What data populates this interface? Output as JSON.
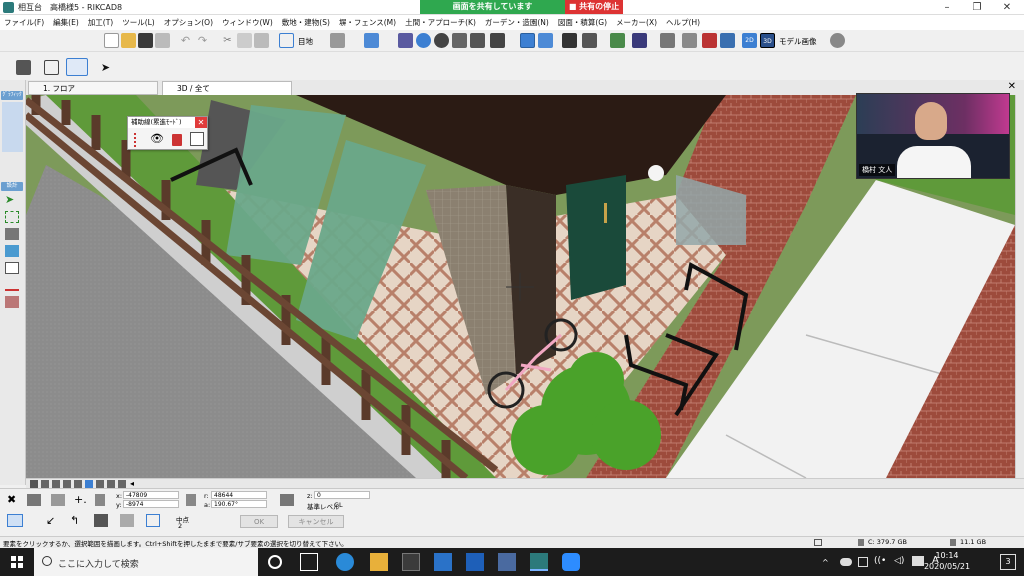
{
  "window": {
    "title": "相互台　高橋様5 - RIKCAD8",
    "sharing_label": "画面を共有しています",
    "stop_share_label": "■ 共有の停止"
  },
  "menu": [
    "ファイル(F)",
    "編集(E)",
    "加工(T)",
    "ツール(L)",
    "オプション(O)",
    "ウィンドウ(W)",
    "敷地・建物(S)",
    "塀・フェンス(M)",
    "土間・アプローチ(K)",
    "ガーデン・造園(N)",
    "図面・積算(G)",
    "メーカー(X)",
    "ヘルプ(H)"
  ],
  "toolbar": {
    "view_dropdown": "目地",
    "model_image_label": "モデル画像",
    "btn_2d": "2D",
    "btn_3d": "3D"
  },
  "tabs": [
    {
      "label": "1. フロア"
    },
    {
      "label": "3D / 全て"
    }
  ],
  "left_palette": {
    "tab1": "ｸﾞﾗﾌｨｯｸ",
    "tab2": "設計"
  },
  "aux_palette": {
    "title": "補助線(累進ﾓｰﾄﾞ)"
  },
  "webcam": {
    "name": "橋村 文人"
  },
  "coords": {
    "x_label": "x:",
    "x_value": "-47809",
    "y_label": "y:",
    "y_value": "-8974",
    "r_label": "r:",
    "r_value": "48644",
    "a_label": "a:",
    "a_value": "190.67°",
    "z_label": "z:",
    "z_value": "0",
    "level_label": "基準レベル",
    "level_value": "GL",
    "midpoint_label": "中点",
    "midpoint_value": "2"
  },
  "buttons": {
    "ok": "OK",
    "cancel": "キャンセル"
  },
  "status": {
    "message": "要素をクリックするか、選択範囲を描画します。Ctrl+Shiftを押したままで要素/サブ要素の選択を切り替えて下さい。",
    "disk_c": "C: 379.7 GB",
    "disk_other": "11.1 GB"
  },
  "taskbar": {
    "search_placeholder": "ここに入力して検索",
    "time": "10:14",
    "date": "2020/05/21",
    "notification_count": "3"
  },
  "colors": {
    "share_green": "#2fa84f",
    "stop_red": "#d33333",
    "accent_blue": "#3c7fd2",
    "taskbar": "#1c1c1c"
  }
}
